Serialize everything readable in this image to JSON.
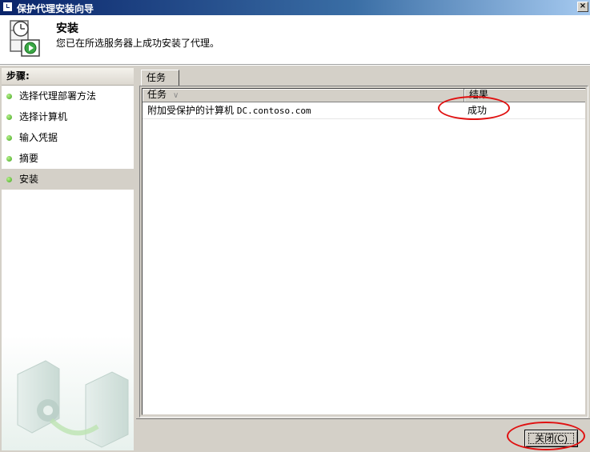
{
  "window": {
    "title": "保护代理安装向导",
    "close_glyph": "×"
  },
  "header": {
    "title": "安装",
    "subtitle": "您已在所选服务器上成功安装了代理。"
  },
  "steps": {
    "heading": "步骤:",
    "items": [
      {
        "label": "选择代理部署方法"
      },
      {
        "label": "选择计算机"
      },
      {
        "label": "输入凭据"
      },
      {
        "label": "摘要"
      },
      {
        "label": "安装"
      }
    ],
    "active_index": 4
  },
  "tab": {
    "label": "任务"
  },
  "list": {
    "columns": {
      "task": "任务",
      "result": "结果"
    },
    "rows": [
      {
        "task_prefix": "附加受保护的计算机",
        "task_computer": "DC.contoso.com",
        "result": "成功"
      }
    ]
  },
  "buttons": {
    "close_label": "关闭(C)"
  },
  "colors": {
    "titlebar_start": "#0a246a",
    "titlebar_end": "#a6caf0",
    "annotation_red": "#e01010",
    "step_dot": "#3fa31c"
  }
}
